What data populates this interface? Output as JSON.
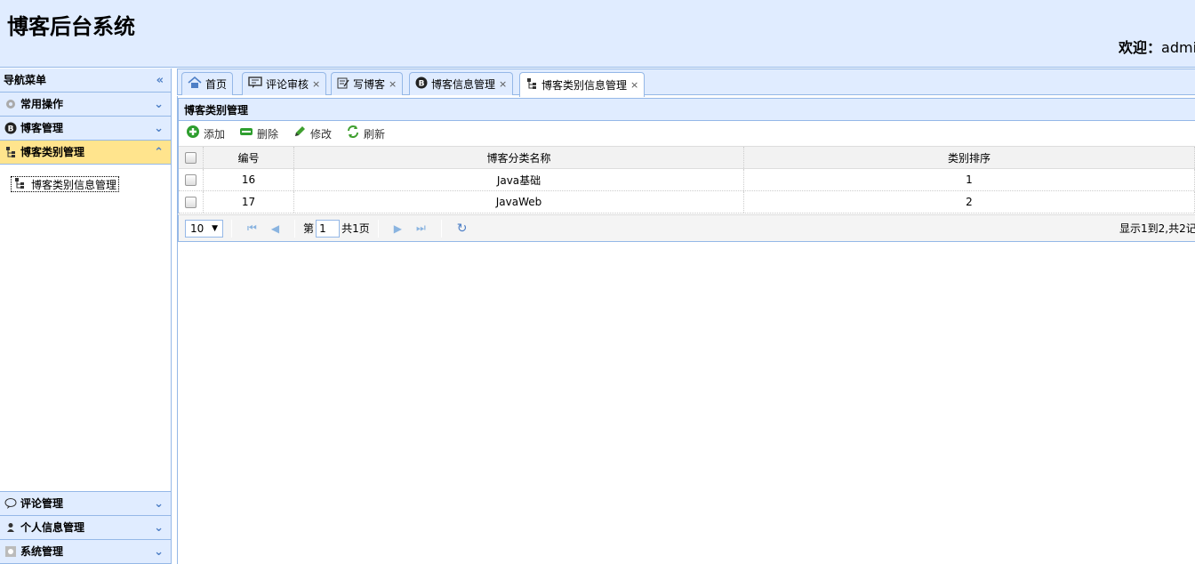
{
  "header": {
    "title": "博客后台系统",
    "welcome_label": "欢迎：",
    "welcome_user": "admi"
  },
  "nav": {
    "title": "导航菜单",
    "sections": [
      {
        "label": "常用操作",
        "icon": "gear-icon"
      },
      {
        "label": "博客管理",
        "icon": "blog-icon"
      },
      {
        "label": "博客类别管理",
        "icon": "tree-icon"
      },
      {
        "label": "评论管理",
        "icon": "comment-icon"
      },
      {
        "label": "个人信息管理",
        "icon": "user-icon"
      },
      {
        "label": "系统管理",
        "icon": "system-icon"
      }
    ],
    "tree_item": "博客类别信息管理"
  },
  "tabs": [
    {
      "label": "首页",
      "closable": false
    },
    {
      "label": "评论审核",
      "closable": true
    },
    {
      "label": "写博客",
      "closable": true
    },
    {
      "label": "博客信息管理",
      "closable": true
    },
    {
      "label": "博客类别信息管理",
      "closable": true
    }
  ],
  "panel": {
    "title": "博客类别管理",
    "toolbar": {
      "add": "添加",
      "delete": "删除",
      "edit": "修改",
      "refresh": "刷新"
    },
    "columns": [
      "编号",
      "博客分类名称",
      "类别排序"
    ],
    "rows": [
      {
        "id": "16",
        "name": "Java基础",
        "sort": "1"
      },
      {
        "id": "17",
        "name": "JavaWeb",
        "sort": "2"
      }
    ],
    "pager": {
      "page_size": "10",
      "page_prefix": "第",
      "page_value": "1",
      "page_total": "共1页",
      "info": "显示1到2,共2记"
    }
  },
  "colors": {
    "header_bg": "#e0ecff",
    "border": "#95b8e7",
    "selected": "#ffe48d"
  }
}
